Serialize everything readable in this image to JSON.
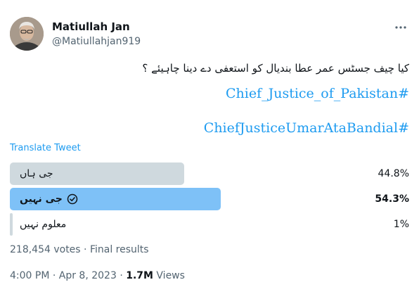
{
  "author": {
    "display_name": "Matiullah Jan",
    "handle": "@Matiullahjan919",
    "avatar_icon": "profile-photo"
  },
  "tweet": {
    "text": "کیا چیف جسٹس عمر عطا بندیال کو استعفی دے دینا چاہیئے ؟",
    "hashtags": [
      "Chief_Justice_of_Pakistan#",
      "ChiefJusticeUmarAtaBandial#"
    ],
    "translate_label": "Translate Tweet"
  },
  "poll": {
    "options": [
      {
        "label": "جی ہاں",
        "percent_text": "44.8%",
        "percent": 44.8,
        "winner": false
      },
      {
        "label": "جی نہیں",
        "percent_text": "54.3%",
        "percent": 54.3,
        "winner": true
      },
      {
        "label": "معلوم نہیں",
        "percent_text": "1%",
        "percent": 1,
        "winner": false
      }
    ],
    "summary": "218,454 votes · Final results"
  },
  "meta": {
    "timestamp": "4:00 PM · Apr 8, 2023 · ",
    "views_count": "1.7M",
    "views_label": " Views"
  },
  "colors": {
    "link": "#1d9bf0",
    "bar_default": "#cfd9de",
    "bar_winner": "#7ec1f7",
    "secondary_text": "#536471"
  }
}
